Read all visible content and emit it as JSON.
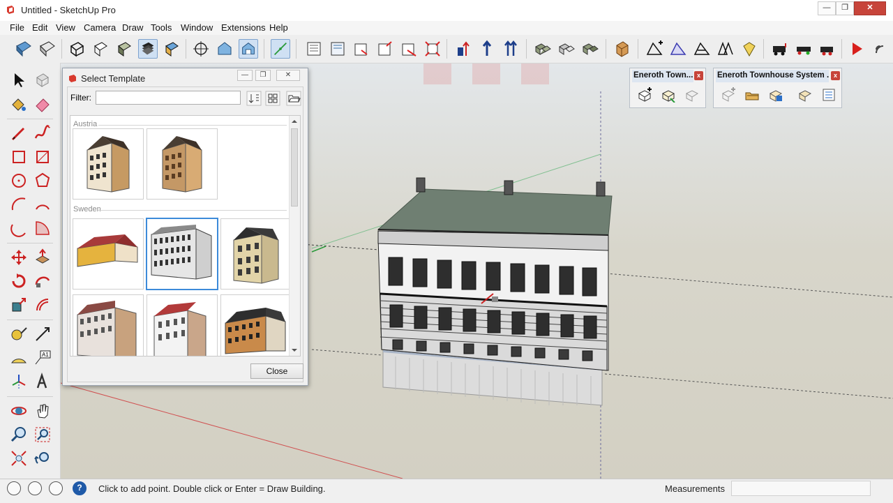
{
  "window": {
    "title": "Untitled - SketchUp Pro",
    "minimize": "—",
    "maximize": "❐",
    "close": "✕"
  },
  "menu": [
    "File",
    "Edit",
    "View",
    "Camera",
    "Draw",
    "Tools",
    "Window",
    "Extensions",
    "Help"
  ],
  "toolbar_icons": [
    "section-plane-icon",
    "section-cut-icon",
    "iso-view-icon",
    "top-view-icon",
    "front-view-icon",
    "style-shaded-icon",
    "style-textured-icon",
    "style-monochrome-icon",
    "position-camera-icon",
    "view-iso-icon",
    "view-top-icon",
    "axes-icon",
    "component-icons"
  ],
  "template_dialog": {
    "title": "Select Template",
    "filter_label": "Filter:",
    "filter_value": "",
    "groups": [
      {
        "label": "Austria",
        "items": [
          "austria-townhouse-1",
          "austria-townhouse-2"
        ]
      },
      {
        "label": "Sweden",
        "items": [
          "sweden-red-roof",
          "sweden-gray-facade",
          "sweden-beige-house",
          "sweden-brick-building",
          "sweden-white-building",
          "sweden-dark-building"
        ]
      }
    ],
    "selected_item": "sweden-gray-facade",
    "close_label": "Close"
  },
  "panels": [
    {
      "title": "Eneroth Town..."
    },
    {
      "title": "Eneroth Townhouse System ..."
    }
  ],
  "status": {
    "message": "Click to add point. Double click or Enter = Draw Building.",
    "measurements_label": "Measurements",
    "measurements_value": ""
  },
  "colors": {
    "viewport_bg": "#d6d3c6",
    "selection_blue": "#3c8ad9",
    "close_red": "#c7443a",
    "roof_green": "#6f7f72"
  }
}
